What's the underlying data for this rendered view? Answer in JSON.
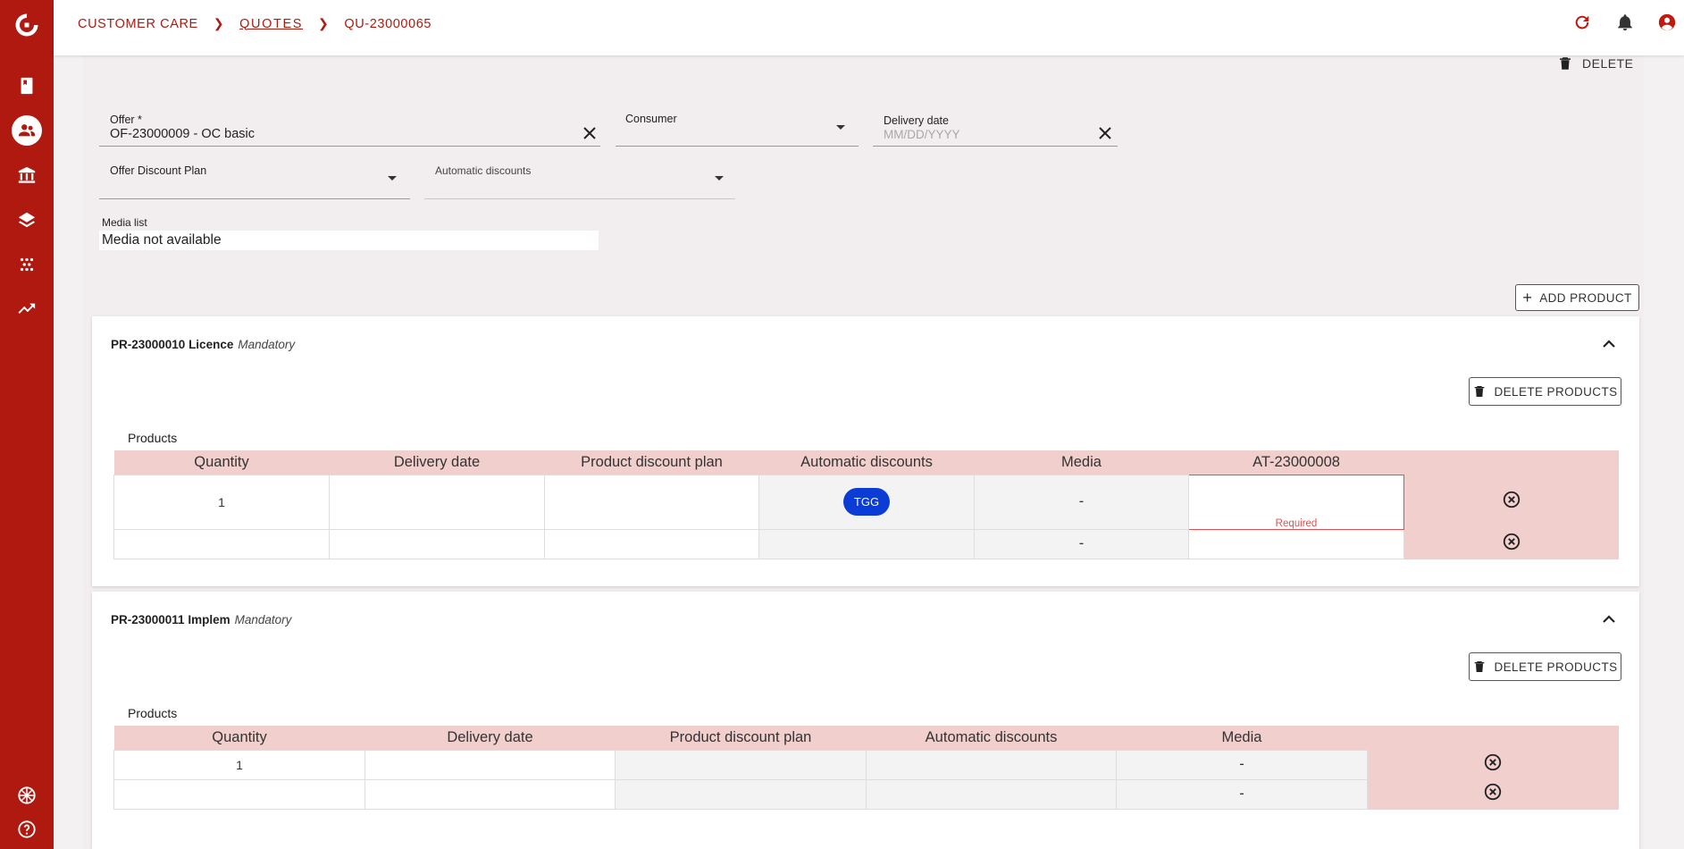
{
  "breadcrumb": {
    "root": "CUSTOMER CARE",
    "section": "QUOTES",
    "current": "QU-23000065"
  },
  "sidebar": {
    "items": [
      "book-icon",
      "customers-icon",
      "bank-icon",
      "layers-icon",
      "dots-icon",
      "trend-icon"
    ],
    "bottom": [
      "language-icon",
      "help-icon"
    ]
  },
  "actions": {
    "delete": "DELETE",
    "add_product": "ADD PRODUCT"
  },
  "form": {
    "offer_label": "Offer *",
    "offer_value": "OF-23000009 - OC basic",
    "consumer_label": "Consumer",
    "consumer_value": "",
    "delivery_label": "Delivery date",
    "delivery_placeholder": "MM/DD/YYYY",
    "offer_discount_label": "Offer Discount Plan",
    "auto_discounts_label": "Automatic discounts",
    "media_list_label": "Media list",
    "media_list_value": "Media not available"
  },
  "products": [
    {
      "code": "PR-23000010 Licence",
      "status": "Mandatory",
      "delete_label": "DELETE PRODUCTS",
      "table_title": "Products",
      "columns": [
        "Quantity",
        "Delivery date",
        "Product discount plan",
        "Automatic discounts",
        "Media",
        "AT-23000008",
        ""
      ],
      "rows": [
        {
          "quantity": "1",
          "discount_badge": "TGG",
          "media": "-",
          "attribute_error": "Required"
        },
        {
          "quantity": "",
          "discount_badge": "",
          "media": "-",
          "attribute_error": ""
        }
      ]
    },
    {
      "code": "PR-23000011 Implem",
      "status": "Mandatory",
      "delete_label": "DELETE PRODUCTS",
      "table_title": "Products",
      "columns": [
        "Quantity",
        "Delivery date",
        "Product discount plan",
        "Automatic discounts",
        "Media",
        ""
      ],
      "rows": [
        {
          "quantity": "1",
          "media": "-"
        },
        {
          "quantity": "",
          "media": "-"
        }
      ]
    }
  ],
  "colors": {
    "brand": "#b0190f",
    "header_fill": "#f0cfcd",
    "badge": "#0b3dd6",
    "error": "#e05050"
  }
}
